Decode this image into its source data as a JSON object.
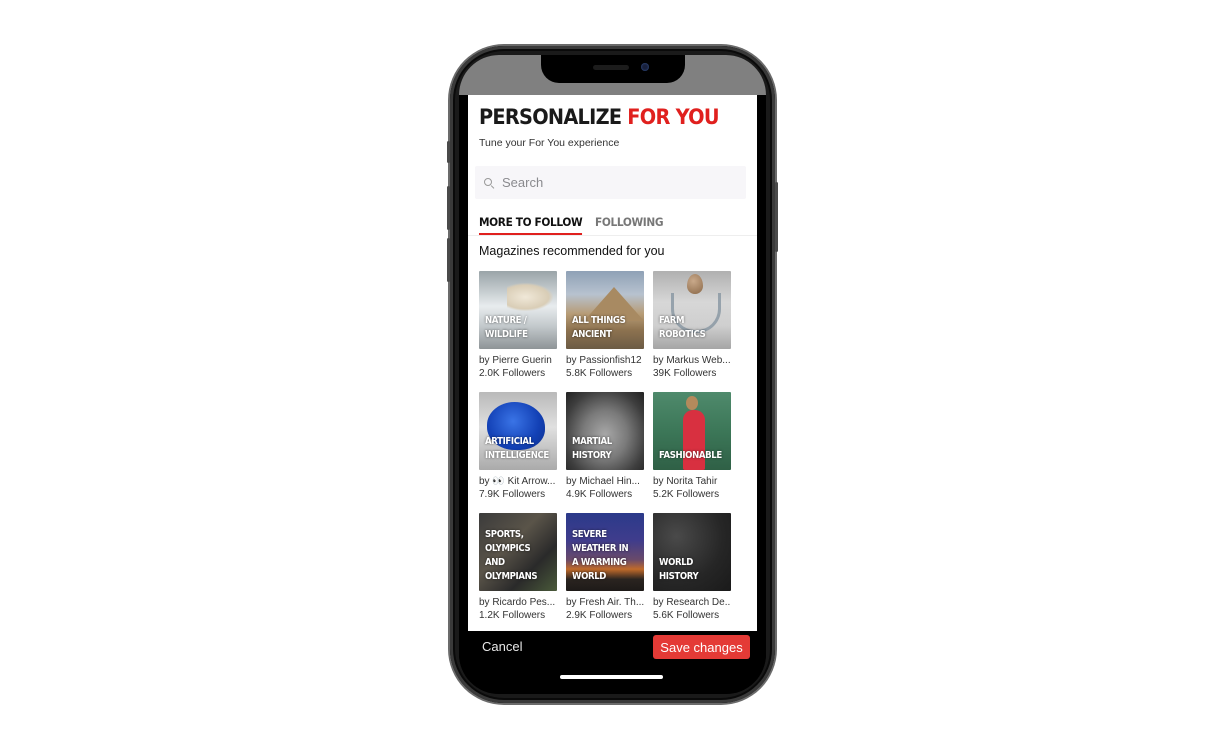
{
  "header": {
    "title_part1": "PERSONALIZE",
    "title_part2": "FOR YOU",
    "subtitle": "Tune your For You experience"
  },
  "search": {
    "placeholder": "Search",
    "value": ""
  },
  "tabs": [
    {
      "label": "MORE TO FOLLOW",
      "active": true
    },
    {
      "label": "FOLLOWING",
      "active": false
    }
  ],
  "section": {
    "title": "Magazines recommended for you"
  },
  "magazines": [
    {
      "title": "NATURE / WILDLIFE",
      "author": "by Pierre Guerin",
      "followers": "2.0K Followers"
    },
    {
      "title": "ALL THINGS ANCIENT",
      "author": "by Passionfish12",
      "followers": "5.8K Followers"
    },
    {
      "title": "FARM ROBOTICS",
      "author": "by Markus Web...",
      "followers": "39K Followers"
    },
    {
      "title": "ARTIFICIAL INTELLIGENCE",
      "author": "by 👀 Kit Arrow...",
      "followers": "7.9K Followers"
    },
    {
      "title": "MARTIAL HISTORY",
      "author": "by Michael Hin...",
      "followers": "4.9K Followers"
    },
    {
      "title": "FASHIONABLE",
      "author": "by Norita Tahir",
      "followers": "5.2K Followers"
    },
    {
      "title": "SPORTS, OLYMPICS AND OLYMPIANS",
      "author": "by Ricardo Pes...",
      "followers": "1.2K Followers"
    },
    {
      "title": "SEVERE WEATHER IN A WARMING WORLD",
      "author": "by Fresh Air. Th...",
      "followers": "2.9K Followers"
    },
    {
      "title": "WORLD HISTORY",
      "author": "by Research De...",
      "followers": "5.6K Followers"
    }
  ],
  "footer": {
    "cancel_label": "Cancel",
    "save_label": "Save changes"
  },
  "colors": {
    "accent": "#e0201e",
    "save_button": "#e43a36",
    "status_overlay": "#808080"
  }
}
